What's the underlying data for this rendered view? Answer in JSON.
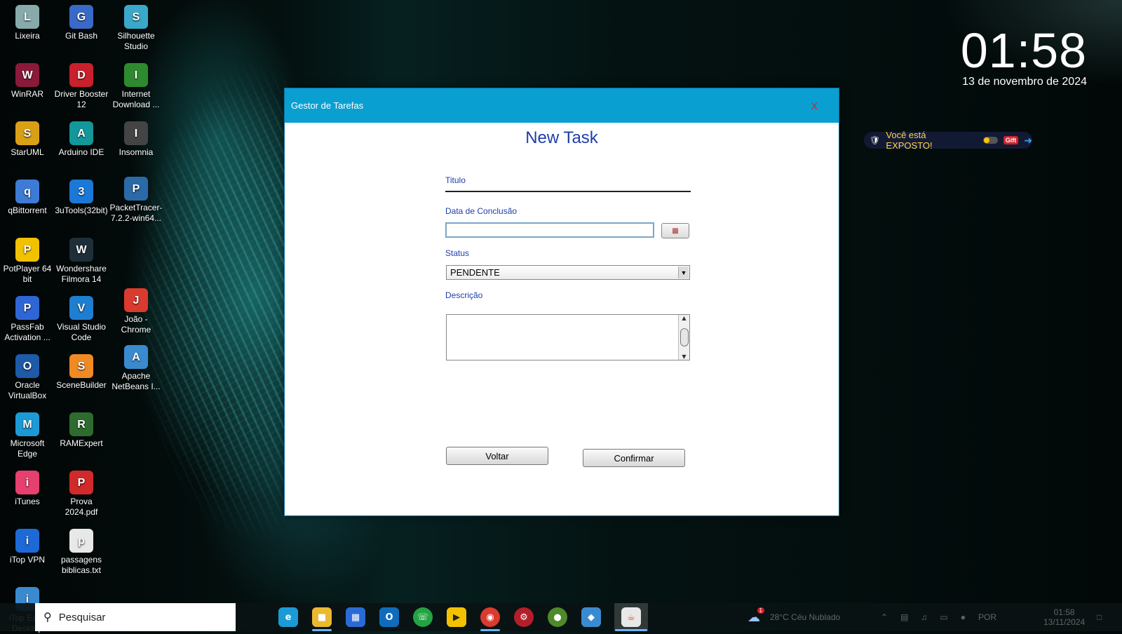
{
  "desktop": {
    "icons": [
      {
        "label": "Lixeira",
        "icon": "recycle-bin-icon",
        "color": "#8aa"
      },
      {
        "label": "Git Bash",
        "icon": "git-bash-icon",
        "color": "#3a6ac8"
      },
      {
        "label": "Silhouette Studio",
        "icon": "silhouette-studio-icon",
        "color": "#3aa9c9"
      },
      {
        "label": "WinRAR",
        "icon": "winrar-icon",
        "color": "#8a1a3a"
      },
      {
        "label": "Driver Booster 12",
        "icon": "driver-booster-icon",
        "color": "#c8202c"
      },
      {
        "label": "Internet Download ...",
        "icon": "internet-download-manager-icon",
        "color": "#2e8a2e"
      },
      {
        "label": "StarUML",
        "icon": "staruml-icon",
        "color": "#d9a015"
      },
      {
        "label": "Arduino IDE",
        "icon": "arduino-icon",
        "color": "#12979b"
      },
      {
        "label": "Insomnia",
        "icon": "insomnia-icon",
        "color": "#444"
      },
      {
        "label": "qBittorrent",
        "icon": "qbittorrent-icon",
        "color": "#3d7bd6"
      },
      {
        "label": "3uTools(32bit)",
        "icon": "3utools-icon",
        "color": "#1b78d6"
      },
      {
        "label": "PacketTracer-7.2.2-win64...",
        "icon": "packet-tracer-icon",
        "color": "#2a6aa8"
      },
      {
        "label": "PotPlayer 64 bit",
        "icon": "potplayer-icon",
        "color": "#f2c200"
      },
      {
        "label": "Wondershare Filmora 14",
        "icon": "filmora-icon",
        "color": "#1f2f3a"
      },
      {
        "label": "PassFab Activation ...",
        "icon": "passfab-icon",
        "color": "#2f66d6"
      },
      {
        "label": "Visual Studio Code",
        "icon": "vscode-icon",
        "color": "#1e7fd1"
      },
      {
        "label": "João - Chrome",
        "icon": "chrome-icon",
        "color": "#db3a2f"
      },
      {
        "label": "Oracle VirtualBox",
        "icon": "virtualbox-icon",
        "color": "#1d5aa8"
      },
      {
        "label": "SceneBuilder",
        "icon": "scenebuilder-icon",
        "color": "#f08a24"
      },
      {
        "label": "Apache NetBeans I...",
        "icon": "netbeans-icon",
        "color": "#3a8ad0"
      },
      {
        "label": "Microsoft Edge",
        "icon": "edge-icon",
        "color": "#1c9ad6"
      },
      {
        "label": "RAMExpert",
        "icon": "ramexpert-icon",
        "color": "#2e6b2e"
      },
      {
        "label": "iTunes",
        "icon": "itunes-icon",
        "color": "#e5406e"
      },
      {
        "label": "Prova 2024.pdf",
        "icon": "pdf-icon",
        "color": "#d22a2a"
      },
      {
        "label": "iTop VPN",
        "icon": "itop-vpn-icon",
        "color": "#1d6ad6"
      },
      {
        "label": "passagens biblicas.txt",
        "icon": "text-file-icon",
        "color": "#e8e8e8"
      },
      {
        "label": "iTop Easy Desktop",
        "icon": "itop-easy-desktop-icon",
        "color": "#3a8ad0"
      }
    ]
  },
  "clock": {
    "time": "01:58",
    "date": "13 de novembro de 2024"
  },
  "vpn": {
    "text": "Você está EXPOSTO!",
    "gift": "Gift"
  },
  "dialog": {
    "title": "Gestor de Tarefas",
    "close": "X",
    "heading": "New Task",
    "titulo_label": "Titulo",
    "data_label": "Data de Conclusão",
    "data_value": "",
    "status_label": "Status",
    "status_value": "PENDENTE",
    "descricao_label": "Descrição",
    "descricao_value": "",
    "voltar": "Voltar",
    "confirmar": "Confirmar"
  },
  "taskbar": {
    "search_placeholder": "Pesquisar",
    "weather": "28°C  Céu Nublado",
    "lang": "POR",
    "time": "01:58",
    "date": "13/11/2024",
    "notification_count": "1"
  }
}
